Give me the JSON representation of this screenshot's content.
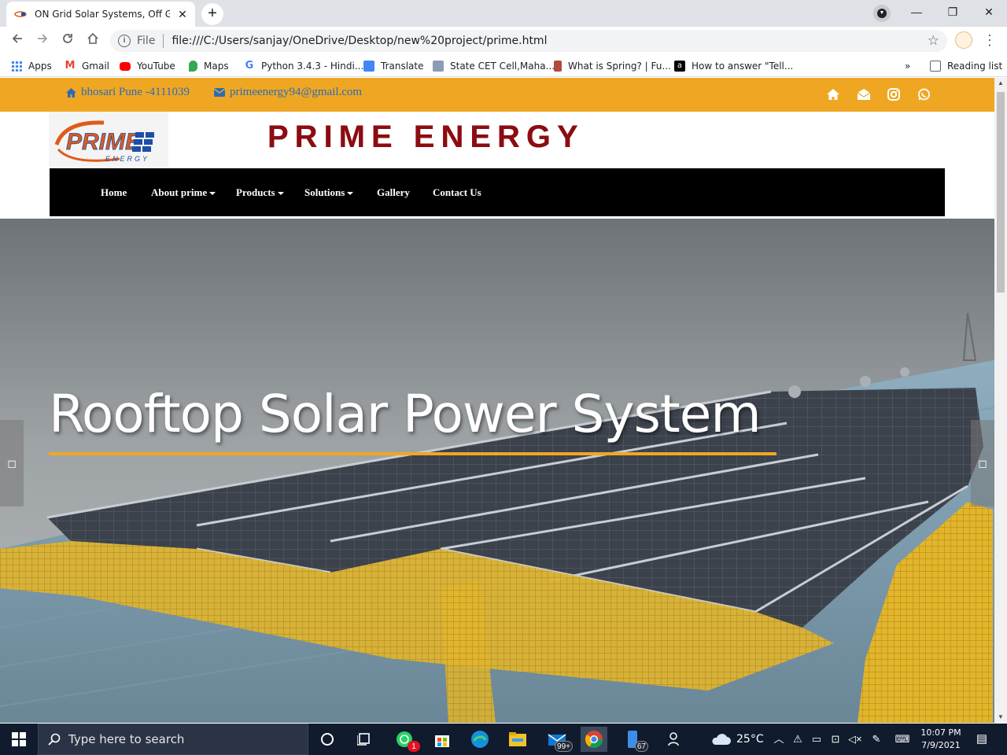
{
  "browser": {
    "tab_title": "ON Grid Solar Systems, Off Grid,",
    "scheme_label": "File",
    "url": "file:///C:/Users/sanjay/OneDrive/Desktop/new%20project/prime.html",
    "bookmarks": [
      {
        "label": "Apps",
        "icon": "apps-grid-icon",
        "color": "#4285f4"
      },
      {
        "label": "Gmail",
        "icon": "gmail-icon",
        "color": "#ea4335"
      },
      {
        "label": "YouTube",
        "icon": "youtube-icon",
        "color": "#ff0000"
      },
      {
        "label": "Maps",
        "icon": "maps-icon",
        "color": "#34a853"
      },
      {
        "label": "Python 3.4.3 - Hindi...",
        "icon": "google-icon",
        "color": "#4285f4"
      },
      {
        "label": "Translate",
        "icon": "translate-icon",
        "color": "#4285f4"
      },
      {
        "label": "State CET Cell,Maha...",
        "icon": "cet-icon",
        "color": "#8b9bb4"
      },
      {
        "label": "What is Spring? | Fu...",
        "icon": "spring-icon",
        "color": "#b34a3a"
      },
      {
        "label": "How to answer \"Tell...",
        "icon": "a-icon",
        "color": "#000000"
      }
    ],
    "overflow_label": "»",
    "reading_list_label": "Reading list"
  },
  "site": {
    "colors": {
      "accent": "#efa723",
      "brand": "#8b0c12",
      "nav_bg": "#000000",
      "link_blue": "#2d6bb8"
    },
    "topbar": {
      "address": "bhosari Pune -4111039",
      "email": "primeenergy94@gmail.com",
      "social_icons": [
        "home-icon",
        "envelope-open-icon",
        "instagram-icon",
        "whatsapp-icon"
      ]
    },
    "logo_text": "PRIME",
    "logo_subtext": "ENERGY",
    "brand_title": "PRIME ENERGY",
    "nav": [
      {
        "label": "Home",
        "dropdown": false
      },
      {
        "label": "About prime",
        "dropdown": true
      },
      {
        "label": "Products",
        "dropdown": true
      },
      {
        "label": "Solutions",
        "dropdown": true
      },
      {
        "label": "Gallery",
        "dropdown": false
      },
      {
        "label": "Contact Us",
        "dropdown": false
      }
    ],
    "hero": {
      "title": "Rooftop Solar Power System",
      "prev_label": "",
      "next_label": ""
    }
  },
  "taskbar": {
    "search_placeholder": "Type here to search",
    "whatsapp_badge": "1",
    "mail_badge": "99+",
    "phone_badge": "67",
    "temperature": "25°C",
    "time": "10:07 PM",
    "date": "7/9/2021"
  }
}
